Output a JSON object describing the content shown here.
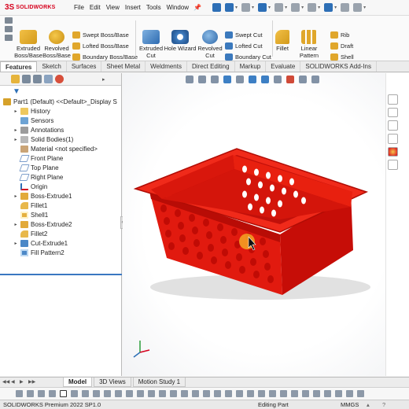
{
  "app": {
    "logo_mark": "3S",
    "logo_text": "SOLIDWORKS"
  },
  "menu": [
    "File",
    "Edit",
    "View",
    "Insert",
    "Tools",
    "Window"
  ],
  "quick_access_icons": [
    "home-icon",
    "new-document-icon",
    "open-folder-icon",
    "save-icon",
    "print-icon",
    "undo-icon",
    "select-arrow-icon",
    "rebuild-icon",
    "file-properties-icon",
    "options-gear-icon"
  ],
  "ribbon": {
    "extruded_boss": "Extruded Boss/Base",
    "revolved_boss": "Revolved Boss/Base",
    "swept_boss": "Swept Boss/Base",
    "lofted_boss": "Lofted Boss/Base",
    "boundary_boss": "Boundary Boss/Base",
    "extruded_cut": "Extruded Cut",
    "hole_wizard": "Hole Wizard",
    "revolved_cut": "Revolved Cut",
    "swept_cut": "Swept Cut",
    "lofted_cut": "Lofted Cut",
    "boundary_cut": "Boundary Cut",
    "fillet": "Fillet",
    "linear_pattern": "Linear Pattern",
    "rib": "Rib",
    "draft": "Draft",
    "shell": "Shell"
  },
  "tabs": [
    "Features",
    "Sketch",
    "Surfaces",
    "Sheet Metal",
    "Weldments",
    "Direct Editing",
    "Markup",
    "Evaluate",
    "SOLIDWORKS Add-Ins"
  ],
  "active_tab": "Features",
  "feature_tree": {
    "root": "Part1 (Default) <<Default>_Display S",
    "items": [
      {
        "label": "History",
        "icon": "folder-icon",
        "expandable": true
      },
      {
        "label": "Sensors",
        "icon": "sensor-icon",
        "expandable": false
      },
      {
        "label": "Annotations",
        "icon": "annotations-icon",
        "expandable": true
      },
      {
        "label": "Solid Bodies(1)",
        "icon": "solid-bodies-icon",
        "expandable": true
      },
      {
        "label": "Material <not specified>",
        "icon": "material-icon",
        "expandable": false
      },
      {
        "label": "Front Plane",
        "icon": "plane-icon",
        "expandable": false
      },
      {
        "label": "Top Plane",
        "icon": "plane-icon",
        "expandable": false
      },
      {
        "label": "Right Plane",
        "icon": "plane-icon",
        "expandable": false
      },
      {
        "label": "Origin",
        "icon": "origin-icon",
        "expandable": false
      },
      {
        "label": "Boss-Extrude1",
        "icon": "extrude-icon",
        "expandable": true
      },
      {
        "label": "Fillet1",
        "icon": "fillet-icon",
        "expandable": false
      },
      {
        "label": "Shell1",
        "icon": "shell-icon",
        "expandable": false
      },
      {
        "label": "Boss-Extrude2",
        "icon": "extrude-icon",
        "expandable": true
      },
      {
        "label": "Fillet2",
        "icon": "fillet-icon",
        "expandable": false
      },
      {
        "label": "Cut-Extrude1",
        "icon": "cut-extrude-icon",
        "expandable": true
      },
      {
        "label": "Fill Pattern2",
        "icon": "pattern-icon",
        "expandable": false
      }
    ]
  },
  "model_tabs": [
    "Model",
    "3D Views",
    "Motion Study 1"
  ],
  "active_model_tab": "Model",
  "status": {
    "version": "SOLIDWORKS Premium 2022 SP1.0",
    "mode": "Editing Part",
    "units": "MMGS"
  },
  "colors": {
    "brand": "#d6001c",
    "part": "#e3120b",
    "accent": "#2d6fb6",
    "cursor_highlight": "#f5a623"
  }
}
